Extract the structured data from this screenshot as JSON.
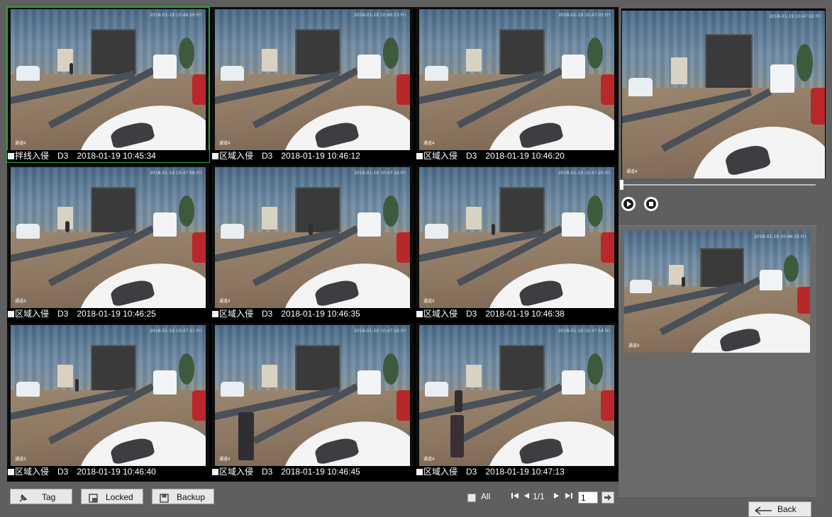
{
  "cells": [
    {
      "event": "拌线入侵",
      "channel": "D3",
      "time": "2018-01-19 10:45:34",
      "stamp": "2018-01-19 10:46:16 Fri",
      "chan_text": "通道4",
      "selected": true
    },
    {
      "event": "区域入侵",
      "channel": "D3",
      "time": "2018-01-19 10:46:12",
      "stamp": "2018-01-19 10:46:13 Fri",
      "chan_text": "通道4"
    },
    {
      "event": "区域入侵",
      "channel": "D3",
      "time": "2018-01-19 10:46:20",
      "stamp": "2018-01-19 10:47:03 Fri",
      "chan_text": "通道4"
    },
    {
      "event": "区域入侵",
      "channel": "D3",
      "time": "2018-01-19 10:46:25",
      "stamp": "2018-01-19 10:47:08 Fri",
      "chan_text": "通道4"
    },
    {
      "event": "区域入侵",
      "channel": "D3",
      "time": "2018-01-19 10:46:35",
      "stamp": "2018-01-19 10:47:16 Fri",
      "chan_text": "通道4"
    },
    {
      "event": "区域入侵",
      "channel": "D3",
      "time": "2018-01-19 10:46:38",
      "stamp": "2018-01-19 10:47:20 Fri",
      "chan_text": "通道4"
    },
    {
      "event": "区域入侵",
      "channel": "D3",
      "time": "2018-01-19 10:46:40",
      "stamp": "2018-01-19 10:47:21 Fri",
      "chan_text": "通道4"
    },
    {
      "event": "区域入侵",
      "channel": "D3",
      "time": "2018-01-19 10:46:45",
      "stamp": "2018-01-19 10:47:28 Fri",
      "chan_text": "通道4"
    },
    {
      "event": "区域入侵",
      "channel": "D3",
      "time": "2018-01-19 10:47:13",
      "stamp": "2018-01-19 10:47:54 Fri",
      "chan_text": "通道4"
    }
  ],
  "toolbar": {
    "tag_label": "Tag",
    "locked_label": "Locked",
    "backup_label": "Backup"
  },
  "pager": {
    "all_label": "All",
    "page_info": "1/1",
    "page_input": "1"
  },
  "preview": {
    "stamp": "2018-01-19 10:47:02 Fri",
    "chan_text": "通道4"
  },
  "thumbnail": {
    "stamp": "2018-01-19 10:46:16 Fri",
    "chan_text": "通道4"
  },
  "back_label": "Back",
  "colors": {
    "background": "#5f5f5f",
    "selected_outline": "#2aa52a",
    "caption_bg": "#000000"
  }
}
